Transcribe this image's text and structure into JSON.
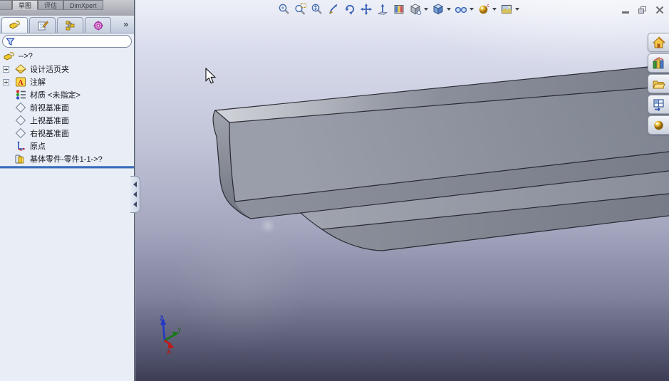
{
  "window": {
    "controls": [
      {
        "name": "minimize"
      },
      {
        "name": "restore"
      },
      {
        "name": "close"
      }
    ]
  },
  "command_tabs": {
    "tabs": [
      {
        "label": "草图",
        "active": true
      },
      {
        "label": "评估",
        "active": false
      },
      {
        "label": "DimXpert",
        "active": false
      }
    ]
  },
  "feature_manager": {
    "tabs": [
      {
        "icon": "feature-tree-icon",
        "active": true
      },
      {
        "icon": "property-manager-icon",
        "active": false
      },
      {
        "icon": "configuration-manager-icon",
        "active": false
      },
      {
        "icon": "dimxpert-manager-icon",
        "active": false
      }
    ],
    "expand_chevron": "»",
    "filter": {
      "value": "",
      "icon": "filter-funnel-icon"
    },
    "tree": {
      "items": [
        {
          "label": "-->?",
          "icon": "part-root-icon",
          "expandable": false
        },
        {
          "label": "设计活页夹",
          "icon": "design-binder-icon",
          "expandable": true
        },
        {
          "label": "注解",
          "icon": "annotations-icon",
          "expandable": true
        },
        {
          "label": "材质 <未指定>",
          "icon": "material-icon",
          "expandable": false
        },
        {
          "label": "前视基准面",
          "icon": "plane-icon",
          "expandable": false
        },
        {
          "label": "上视基准面",
          "icon": "plane-icon",
          "expandable": false
        },
        {
          "label": "右视基准面",
          "icon": "plane-icon",
          "expandable": false
        },
        {
          "label": "原点",
          "icon": "origin-icon",
          "expandable": false
        },
        {
          "label": "基体零件-零件1-1->?",
          "icon": "base-part-icon",
          "expandable": false
        }
      ]
    },
    "rollback_color": "#2e63b2"
  },
  "headsup_toolbar": {
    "items": [
      {
        "icon": "zoom-to-fit-icon",
        "dropdown": false
      },
      {
        "icon": "zoom-to-area-icon",
        "dropdown": false
      },
      {
        "icon": "zoom-in-out-icon",
        "dropdown": false
      },
      {
        "icon": "view-sketch-pen-icon",
        "dropdown": false
      },
      {
        "icon": "rotate-view-icon",
        "dropdown": false
      },
      {
        "icon": "pan-view-icon",
        "dropdown": false
      },
      {
        "icon": "normal-to-icon",
        "dropdown": false
      },
      {
        "icon": "section-view-icon",
        "dropdown": false
      },
      {
        "icon": "view-orientation-icon",
        "dropdown": true
      },
      {
        "icon": "display-style-icon",
        "dropdown": true
      },
      {
        "icon": "hide-show-items-icon",
        "dropdown": true
      },
      {
        "icon": "edit-appearance-icon",
        "dropdown": true
      },
      {
        "icon": "scene-icon",
        "dropdown": true
      }
    ]
  },
  "task_pane": {
    "items": [
      {
        "icon": "resources-home-icon"
      },
      {
        "icon": "design-library-icon"
      },
      {
        "icon": "file-explorer-folder-icon"
      },
      {
        "icon": "view-palette-icon"
      },
      {
        "icon": "appearances-sphere-icon"
      }
    ]
  },
  "viewport_scene": {
    "triad": {
      "z": "Z",
      "y": "y",
      "x": "X"
    },
    "colors": {
      "background_top": "#eef0f8",
      "background_bottom": "#3c3d55",
      "model_gray": "#8a8f9c",
      "model_edge": "#1a1a22",
      "triad_z": "#2233cc",
      "triad_y": "#157815",
      "triad_x": "#c01818"
    }
  }
}
